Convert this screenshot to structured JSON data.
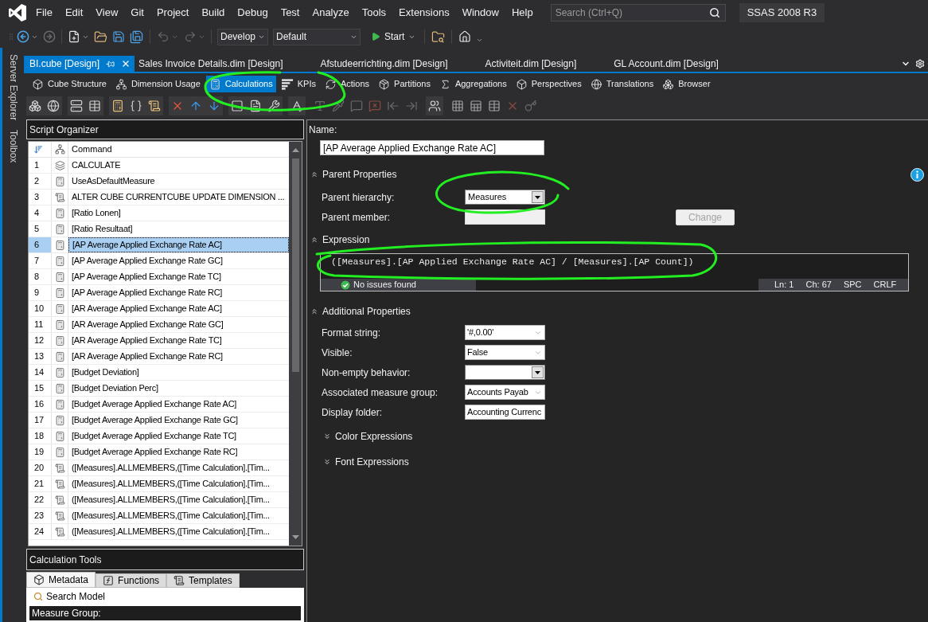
{
  "menu_bar": {
    "items": [
      "File",
      "Edit",
      "View",
      "Git",
      "Project",
      "Build",
      "Debug",
      "Test",
      "Analyze",
      "Tools",
      "Extensions",
      "Window",
      "Help"
    ],
    "search": {
      "placeholder": "Search (Ctrl+Q)"
    },
    "solution": "SSAS 2008 R3"
  },
  "toolbar": {
    "configuration": "Develop",
    "platform": "Default",
    "start": "Start"
  },
  "side_tabs": [
    "Server Explorer",
    "Toolbox"
  ],
  "document_tabs": [
    {
      "label": "BI.cube [Design]",
      "selected": true
    },
    {
      "label": "Sales Invoice Details.dim [Design]",
      "selected": false
    },
    {
      "label": "Afstudeerrichting.dim [Design]",
      "selected": false
    },
    {
      "label": "Activiteit.dim [Design]",
      "selected": false
    },
    {
      "label": "GL Account.dim [Design]",
      "selected": false
    }
  ],
  "designer_tabs": [
    {
      "label": "Cube Structure",
      "selected": false
    },
    {
      "label": "Dimension Usage",
      "selected": false
    },
    {
      "label": "Calculations",
      "selected": true
    },
    {
      "label": "KPIs",
      "selected": false
    },
    {
      "label": "Actions",
      "selected": false
    },
    {
      "label": "Partitions",
      "selected": false
    },
    {
      "label": "Aggregations",
      "selected": false
    },
    {
      "label": "Perspectives",
      "selected": false
    },
    {
      "label": "Translations",
      "selected": false
    },
    {
      "label": "Browser",
      "selected": false
    }
  ],
  "script_organizer": {
    "title": "Script Organizer",
    "command_header": "Command",
    "rows": [
      {
        "number": "1",
        "kind": "calculate",
        "command": "CALCULATE",
        "selected": false
      },
      {
        "number": "2",
        "kind": "member",
        "command": "UseAsDefaultMeasure",
        "selected": false
      },
      {
        "number": "3",
        "kind": "script",
        "command": "ALTER CUBE CURRENTCUBE UPDATE DIMENSION ...",
        "selected": false
      },
      {
        "number": "4",
        "kind": "member",
        "command": "[Ratio Lonen]",
        "selected": false
      },
      {
        "number": "5",
        "kind": "member",
        "command": "[Ratio Resultaat]",
        "selected": false
      },
      {
        "number": "6",
        "kind": "member",
        "command": "[AP Average Applied Exchange Rate AC]",
        "selected": true
      },
      {
        "number": "7",
        "kind": "member",
        "command": "[AP Average Applied Exchange Rate GC]",
        "selected": false
      },
      {
        "number": "8",
        "kind": "member",
        "command": "[AP Average Applied Exchange Rate TC]",
        "selected": false
      },
      {
        "number": "9",
        "kind": "member",
        "command": "[AP Average Applied Exchange Rate RC]",
        "selected": false
      },
      {
        "number": "10",
        "kind": "member",
        "command": "[AR Average Applied Exchange Rate AC]",
        "selected": false
      },
      {
        "number": "11",
        "kind": "member",
        "command": "[AR Average Applied Exchange Rate GC]",
        "selected": false
      },
      {
        "number": "12",
        "kind": "member",
        "command": "[AR Average Applied Exchange Rate TC]",
        "selected": false
      },
      {
        "number": "13",
        "kind": "member",
        "command": "[AR Average Applied Exchange Rate RC]",
        "selected": false
      },
      {
        "number": "14",
        "kind": "member",
        "command": "[Budget Deviation]",
        "selected": false
      },
      {
        "number": "15",
        "kind": "member",
        "command": "[Budget Deviation Perc]",
        "selected": false
      },
      {
        "number": "16",
        "kind": "member",
        "command": "[Budget Average Applied Exchange Rate AC]",
        "selected": false
      },
      {
        "number": "17",
        "kind": "member",
        "command": "[Budget Average Applied Exchange Rate GC]",
        "selected": false
      },
      {
        "number": "18",
        "kind": "member",
        "command": "[Budget Average Applied Exchange Rate TC]",
        "selected": false
      },
      {
        "number": "19",
        "kind": "member",
        "command": "[Budget Average Applied Exchange Rate RC]",
        "selected": false
      },
      {
        "number": "20",
        "kind": "script",
        "command": "([Measures].ALLMEMBERS,([Time Calculation].[Tim...",
        "selected": false
      },
      {
        "number": "21",
        "kind": "script",
        "command": "([Measures].ALLMEMBERS,([Time Calculation].[Tim...",
        "selected": false
      },
      {
        "number": "22",
        "kind": "script",
        "command": "([Measures].ALLMEMBERS,([Time Calculation].[Tim...",
        "selected": false
      },
      {
        "number": "23",
        "kind": "script",
        "command": "([Measures].ALLMEMBERS,([Time Calculation].[Tim...",
        "selected": false
      },
      {
        "number": "24",
        "kind": "script",
        "command": "([Measures].ALLMEMBERS,([Time Calculation].[Tim...",
        "selected": false
      }
    ]
  },
  "calculation_tools": {
    "title": "Calculation Tools",
    "tabs": [
      {
        "label": "Metadata",
        "selected": true
      },
      {
        "label": "Functions",
        "selected": false
      },
      {
        "label": "Templates",
        "selected": false
      }
    ],
    "search": "Search Model",
    "measure_group": "Measure Group:"
  },
  "properties": {
    "name": {
      "label": "Name:",
      "value": "[AP Average Applied Exchange Rate AC]"
    },
    "parent_properties": {
      "title": "Parent Properties",
      "expanded": true,
      "hierarchy": {
        "label": "Parent hierarchy:",
        "value": "Measures",
        "kind": "dropdown"
      },
      "member": {
        "label": "Parent member:",
        "kind": "text",
        "disabled": true
      },
      "change_button": {
        "label": "Change",
        "disabled": true
      }
    },
    "expression": {
      "title": "Expression",
      "expanded": true,
      "code": "([Measures].[AP Applied Exchange Rate AC] / [Measures].[AP Count])",
      "status": "No issues found",
      "cursor_info": [
        "Ln: 1",
        "Ch: 67",
        "SPC",
        "CRLF"
      ]
    },
    "additional_properties": {
      "title": "Additional Properties",
      "expanded": true,
      "fields": [
        {
          "label": "Format string:",
          "value": "'#,0.00'",
          "kind": "combo"
        },
        {
          "label": "Visible:",
          "value": "False",
          "kind": "combo"
        },
        {
          "label": "Non-empty behavior:",
          "kind": "dropdown"
        },
        {
          "label": "Associated measure group:",
          "value": "Accounts Payab",
          "kind": "combo"
        },
        {
          "label": "Display folder:",
          "value": "Accounting Currenc",
          "kind": "text"
        }
      ]
    },
    "color_expressions": {
      "title": "Color Expressions",
      "expanded": false
    },
    "font_expressions": {
      "title": "Font Expressions",
      "expanded": false
    }
  }
}
